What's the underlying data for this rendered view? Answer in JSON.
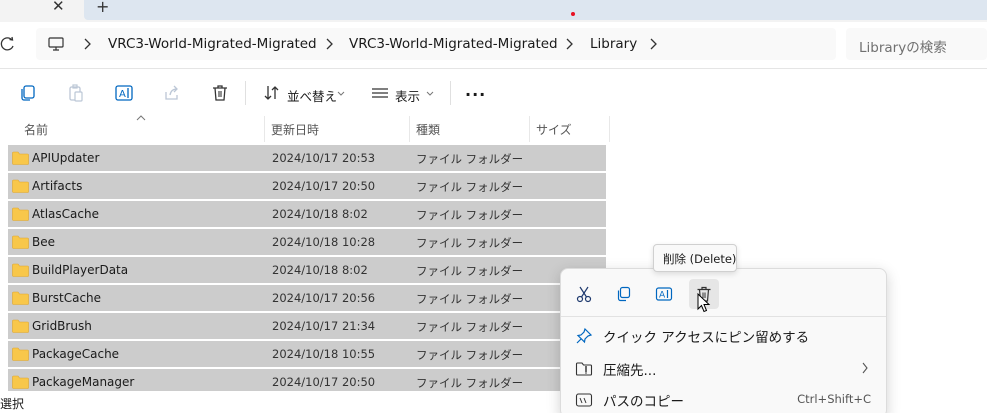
{
  "tabstrip": {
    "close_glyph": "✕",
    "add_glyph": "+"
  },
  "address": {
    "crumbs": [
      "VRC3-World-Migrated-Migrated",
      "VRC3-World-Migrated-Migrated",
      "Library"
    ],
    "search_placeholder": "Libraryの検索"
  },
  "toolbar": {
    "sort_label": "並べ替え",
    "view_label": "表示",
    "more_label": "..."
  },
  "columns": {
    "name": "名前",
    "date": "更新日時",
    "type": "種類",
    "size": "サイズ"
  },
  "rows": [
    {
      "name": "APIUpdater",
      "date": "2024/10/17 20:53",
      "type": "ファイル フォルダー"
    },
    {
      "name": "Artifacts",
      "date": "2024/10/17 20:50",
      "type": "ファイル フォルダー"
    },
    {
      "name": "AtlasCache",
      "date": "2024/10/18 8:02",
      "type": "ファイル フォルダー"
    },
    {
      "name": "Bee",
      "date": "2024/10/18 10:28",
      "type": "ファイル フォルダー"
    },
    {
      "name": "BuildPlayerData",
      "date": "2024/10/18 8:02",
      "type": "ファイル フォルダー"
    },
    {
      "name": "BurstCache",
      "date": "2024/10/17 20:56",
      "type": "ファイル フォルダー"
    },
    {
      "name": "GridBrush",
      "date": "2024/10/17 21:34",
      "type": "ファイル フォルダー"
    },
    {
      "name": "PackageCache",
      "date": "2024/10/18 10:55",
      "type": "ファイル フォルダー"
    },
    {
      "name": "PackageManager",
      "date": "2024/10/17 20:50",
      "type": "ファイル フォルダー"
    }
  ],
  "status": {
    "text": "選択"
  },
  "tooltip": {
    "text": "削除 (Delete)"
  },
  "context_menu": {
    "icons": [
      "scissors-icon",
      "copy-icon",
      "rename-icon",
      "trash-icon"
    ],
    "items": [
      {
        "label": "クイック アクセスにピン留めする",
        "icon": "pin-icon"
      },
      {
        "label": "圧縮先...",
        "icon": "zip-folder-icon",
        "has_submenu": true
      },
      {
        "label": "パスのコピー",
        "icon": "path-icon",
        "shortcut": "Ctrl+Shift+C"
      }
    ]
  },
  "colors": {
    "selection": "#cccccc",
    "folder": "#f8c74a",
    "accent": "#0067c0"
  }
}
